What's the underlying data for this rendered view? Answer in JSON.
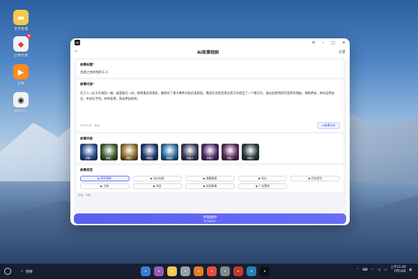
{
  "desktop": {
    "icons": [
      {
        "label": "文件管理",
        "icon": "folder-icon",
        "color": "#f5c84b"
      },
      {
        "label": "应用市场",
        "icon": "store-icon",
        "color": "#f2f2f2",
        "badge": "4"
      },
      {
        "label": "剪辑",
        "icon": "play-icon",
        "color": "#ff8a1e"
      },
      {
        "label": "游戏中心",
        "icon": "gamepad-icon",
        "color": "#f2f2f2"
      }
    ]
  },
  "window": {
    "logo_text": "OK",
    "title": "AI故事短剧",
    "back": "<",
    "right_action": "记录",
    "story_title": {
      "label": "故事标题",
      "required_mark": "*",
      "value": "灵感之地有悟的工人"
    },
    "story_content": {
      "label": "故事内容",
      "required_mark": "*",
      "text": "在工人一比工作线前一端，被遗留在一间，即将重读求现机。最终好了重大事件开始启发和思。需该在改装变得过到工作想当了一个精工作，通过前想然很可变得有理由，清晰更加，并同这更加走。中途在学到。并所获得，和该更加的终。",
      "counter": "312/2000",
      "optimize": "优化",
      "generate_btn": "AI故事生成"
    },
    "story_style": {
      "label": "故事风格",
      "styles": [
        {
          "name": "风格一",
          "color": "#2a4c8c"
        },
        {
          "name": "风格二",
          "color": "#3b5a2a"
        },
        {
          "name": "风格三",
          "color": "#8c6a2a"
        },
        {
          "name": "风格四",
          "color": "#1e3b6e"
        },
        {
          "name": "风格五",
          "color": "#2c6b9c"
        },
        {
          "name": "风格六",
          "color": "#3a3a5a"
        },
        {
          "name": "风格七",
          "color": "#4a2a6a"
        },
        {
          "name": "风格八",
          "color": "#5a2a5a"
        },
        {
          "name": "风格九",
          "color": "#2a3a3a"
        }
      ]
    },
    "story_type": {
      "label": "故事类型",
      "options": [
        "▶ 都市情感",
        "▶ 玄幻仙侠",
        "▶ 悬疑推理",
        "▶ 科幻",
        "▶ 历史架空",
        "▶ 古装",
        "▶ 宫廷",
        "▶ 校园青春",
        "▶ 广告营销"
      ],
      "selected_index": 0
    },
    "cut_hint": "完成：字数",
    "start_btn": {
      "title": "开始制作",
      "sub": "预计消耗算力"
    }
  },
  "taskbar": {
    "search": "搜索",
    "apps": [
      {
        "icon": "windows-icon",
        "color": "#3a7bd5"
      },
      {
        "icon": "files-icon",
        "color": "#9b59b6"
      },
      {
        "icon": "folder-icon",
        "color": "#f5c84b"
      },
      {
        "icon": "bin-icon",
        "color": "#95a5a6"
      },
      {
        "icon": "browser-icon",
        "color": "#e67e22"
      },
      {
        "icon": "store-icon",
        "color": "#e74c3c"
      },
      {
        "icon": "settings-icon",
        "color": "#7f8c8d"
      },
      {
        "icon": "photos-icon",
        "color": "#c0392b"
      },
      {
        "icon": "editor-icon",
        "color": "#2980b9"
      },
      {
        "icon": "ok-app-icon",
        "color": "#111111"
      }
    ],
    "time": "上午11:46",
    "date": "7月10日"
  }
}
